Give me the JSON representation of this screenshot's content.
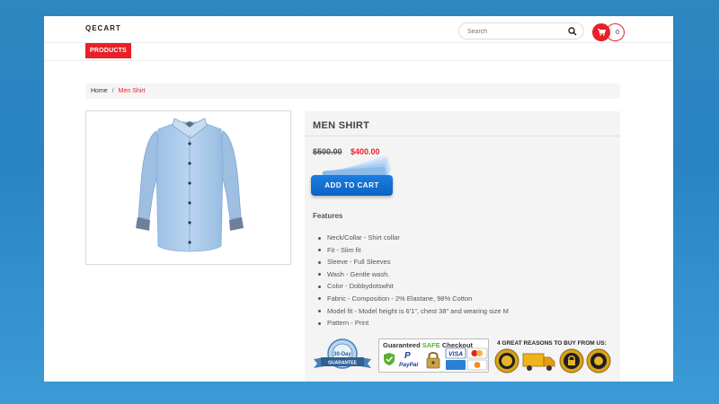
{
  "header": {
    "logo": "QECART",
    "search_placeholder": "Search",
    "cart_count": "0"
  },
  "nav": {
    "products_label": "PRODUCTS"
  },
  "breadcrumb": {
    "home": "Home",
    "separator": "/",
    "current": "Men Shirt"
  },
  "product": {
    "title": "MEN SHIRT",
    "old_price": "$500.00",
    "new_price": "$400.00",
    "add_to_cart_label": "ADD TO CART",
    "features_heading": "Features",
    "features": [
      "Neck/Collar - Shirt collar",
      "Fit - Slim fit",
      "Sleeve - Full Sleeves",
      "Wash - Gentle wash.",
      "Color - Dobbydotswhit",
      "Fabric - Composition - 2% Elastane, 98% Cotton",
      "Model fit - Model height is 6'1\", chest 38\" and wearing size M",
      "Pattern - Print"
    ]
  },
  "badges": {
    "money_back": {
      "line1": "30-Day",
      "line2": "GUARANTEE"
    },
    "checkout_prefix": "Guaranteed ",
    "checkout_safe": "SAFE",
    "checkout_suffix": " Checkout",
    "paypal": "PayPal",
    "visa": "VISA",
    "reasons_title": "4 GREAT REASONS TO BUY FROM US:",
    "reason_icons": [
      "quality-seal-icon",
      "delivery-truck-icon",
      "secure-lock-seal-icon",
      "gold-seal-icon"
    ]
  },
  "colors": {
    "accent_red": "#e8202a",
    "button_blue": "#0b63c4",
    "background_blue": "#2f86c0"
  }
}
